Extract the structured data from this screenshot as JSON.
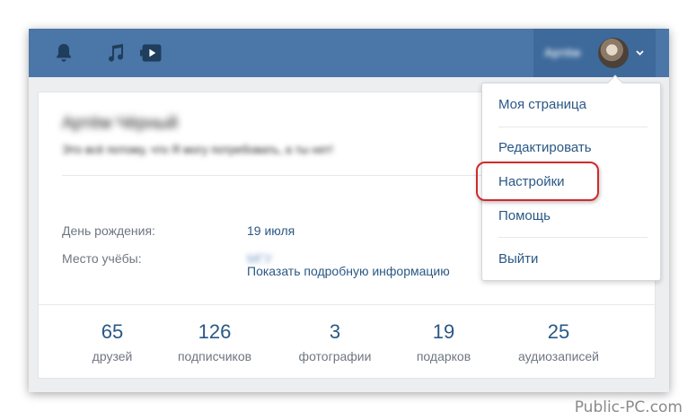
{
  "topbar": {
    "user_name": "Артём",
    "icons": [
      "bell-icon",
      "music-note-icon",
      "video-play-icon"
    ]
  },
  "profile": {
    "name": "Артём Чёрный",
    "status": "Это всё потому, что Я могу потребовать, а ты нет!",
    "birthday_label": "День рождения:",
    "birthday_value": "19 июля",
    "school_label": "Место учёбы:",
    "school_value": "МГУ",
    "more_link": "Показать подробную информацию"
  },
  "stats": [
    {
      "count": "65",
      "label": "друзей"
    },
    {
      "count": "126",
      "label": "подписчиков"
    },
    {
      "count": "3",
      "label": "фотографии"
    },
    {
      "count": "19",
      "label": "подарков"
    },
    {
      "count": "25",
      "label": "аудиозаписей"
    }
  ],
  "menu": {
    "items": [
      "Моя страница",
      "Редактировать",
      "Настройки",
      "Помощь",
      "Выйти"
    ],
    "highlighted": "Настройки"
  },
  "colors": {
    "header": "#4a76a8",
    "link": "#2a5885",
    "highlight": "#d12a2a"
  },
  "watermark": "Public-PC.com"
}
